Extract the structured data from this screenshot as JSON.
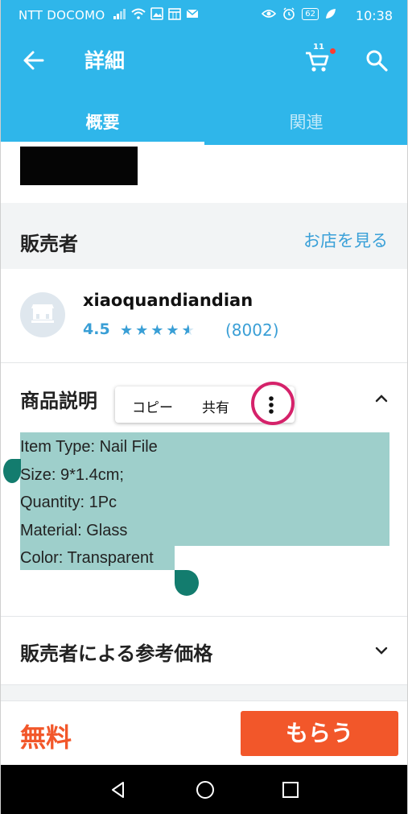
{
  "status_bar": {
    "carrier": "NTT DOCOMO",
    "battery": "62",
    "time": "10:38"
  },
  "app_bar": {
    "title": "詳細",
    "cart_count": "11"
  },
  "tabs": [
    {
      "label": "概要",
      "active": true
    },
    {
      "label": "関連",
      "active": false
    }
  ],
  "seller_section": {
    "label": "販売者",
    "store_link": "お店を見る"
  },
  "seller": {
    "name": "xiaoquandiandian",
    "rating": "4.5",
    "rating_value": 4.5,
    "reviews": "(8002)"
  },
  "description": {
    "title": "商品説明",
    "lines": [
      "Item Type: Nail File",
      "Size: 9*1.4cm;",
      "Quantity: 1Pc",
      "Material: Glass",
      "Color: Transparent"
    ]
  },
  "context_menu": {
    "copy": "コピー",
    "share": "共有"
  },
  "reference_price": {
    "title": "販売者による参考価格"
  },
  "bottom": {
    "price": "無料",
    "button": "もらう"
  },
  "colors": {
    "primary": "#2fb6ea",
    "accent": "#f2572a",
    "selection": "#9ecfcb",
    "ring": "#d5226a"
  }
}
